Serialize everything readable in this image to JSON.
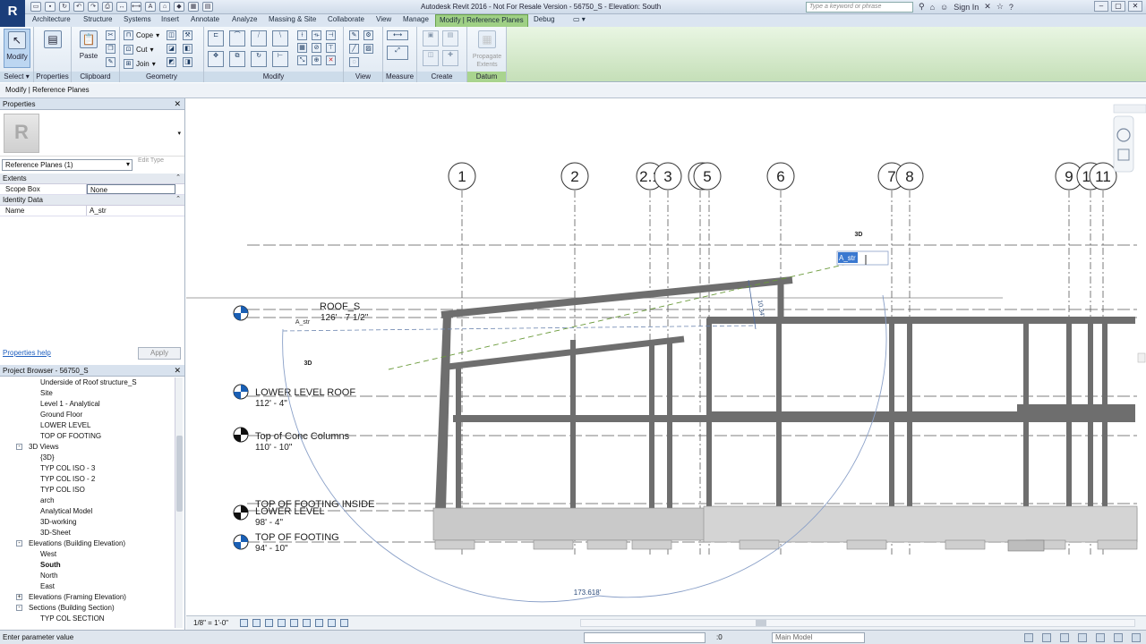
{
  "app": {
    "title": "Autodesk Revit 2016 - Not For Resale Version -   56750_S - Elevation: South",
    "logo": "R",
    "search_placeholder": "Type a keyword or phrase",
    "sign_in": "Sign In"
  },
  "tabs": [
    "Architecture",
    "Structure",
    "Systems",
    "Insert",
    "Annotate",
    "Analyze",
    "Massing & Site",
    "Collaborate",
    "View",
    "Manage",
    "Modify | Reference Planes",
    "Debug"
  ],
  "ribbon": {
    "select": {
      "modify_label": "Modify",
      "panel_label": "Select ▾"
    },
    "properties": {
      "panel_label": "Properties"
    },
    "clipboard": {
      "paste_label": "Paste",
      "panel_label": "Clipboard"
    },
    "geometry": {
      "cope_label": "Cope",
      "cut_label": "Cut",
      "join_label": "Join",
      "panel_label": "Geometry"
    },
    "modify": {
      "panel_label": "Modify"
    },
    "view": {
      "panel_label": "View"
    },
    "measure": {
      "panel_label": "Measure"
    },
    "create": {
      "panel_label": "Create"
    },
    "datum": {
      "propagate_label": "Propagate Extents",
      "panel_label": "Datum"
    }
  },
  "context_bar": "Modify | Reference Planes",
  "properties": {
    "header": "Properties",
    "type_selector": "Reference Planes (1)",
    "edit_type": "Edit Type",
    "groups": [
      {
        "name": "Extents",
        "rows": [
          {
            "key": "Scope Box",
            "value": "None"
          }
        ]
      },
      {
        "name": "Identity Data",
        "rows": [
          {
            "key": "Name",
            "value": "A_str"
          }
        ]
      }
    ],
    "help": "Properties help",
    "apply": "Apply"
  },
  "project_browser": {
    "header": "Project Browser - 56750_S",
    "items": [
      {
        "label": "Underside of Roof structure_S",
        "level": 2
      },
      {
        "label": "Site",
        "level": 2
      },
      {
        "label": "Level 1 - Analytical",
        "level": 2
      },
      {
        "label": "Ground Floor",
        "level": 2
      },
      {
        "label": "LOWER LEVEL",
        "level": 2
      },
      {
        "label": "TOP OF FOOTING",
        "level": 2
      },
      {
        "label": "3D Views",
        "level": 1,
        "toggle": "-"
      },
      {
        "label": "{3D}",
        "level": 2
      },
      {
        "label": "TYP COL ISO - 3",
        "level": 2
      },
      {
        "label": "TYP COL ISO - 2",
        "level": 2
      },
      {
        "label": "TYP COL ISO",
        "level": 2
      },
      {
        "label": "arch",
        "level": 2
      },
      {
        "label": "Analytical Model",
        "level": 2
      },
      {
        "label": "3D-working",
        "level": 2
      },
      {
        "label": "3D-Sheet",
        "level": 2
      },
      {
        "label": "Elevations (Building Elevation)",
        "level": 1,
        "toggle": "-"
      },
      {
        "label": "West",
        "level": 2
      },
      {
        "label": "South",
        "level": 2,
        "bold": true
      },
      {
        "label": "North",
        "level": 2
      },
      {
        "label": "East",
        "level": 2
      },
      {
        "label": "Elevations (Framing Elevation)",
        "level": 1,
        "toggle": "+"
      },
      {
        "label": "Sections (Building Section)",
        "level": 1,
        "toggle": "-"
      },
      {
        "label": "TYP COL SECTION",
        "level": 2
      }
    ]
  },
  "drawing": {
    "grids": [
      "1",
      "2",
      "2.1",
      "3",
      "4",
      "5",
      "6",
      "7",
      "8",
      "9",
      "10",
      "11"
    ],
    "levels": [
      {
        "name": "ROOF_S",
        "elev": "126' - 7 1/2\""
      },
      {
        "name": "LOWER LEVEL ROOF",
        "elev": "112' - 4\""
      },
      {
        "name": "Top of Conc Columns",
        "elev": "110' - 10\""
      },
      {
        "name": "TOP OF FOOTING INSIDE",
        "elev": ""
      },
      {
        "name": "LOWER LEVEL",
        "elev": "98' - 4\""
      },
      {
        "name": "TOP OF FOOTING",
        "elev": "94' - 10\""
      }
    ],
    "ref_plane_name": "A_str",
    "arc_dimension": "173.618'",
    "small_dimension": "10.34'",
    "tag_3d_a": "3D",
    "tag_3d_b": "3D",
    "angle_label": "A_str"
  },
  "view_control": {
    "scale": "1/8\" = 1'-0\""
  },
  "status": {
    "message": "Enter parameter value",
    "coord": ":0",
    "model": "Main Model"
  }
}
